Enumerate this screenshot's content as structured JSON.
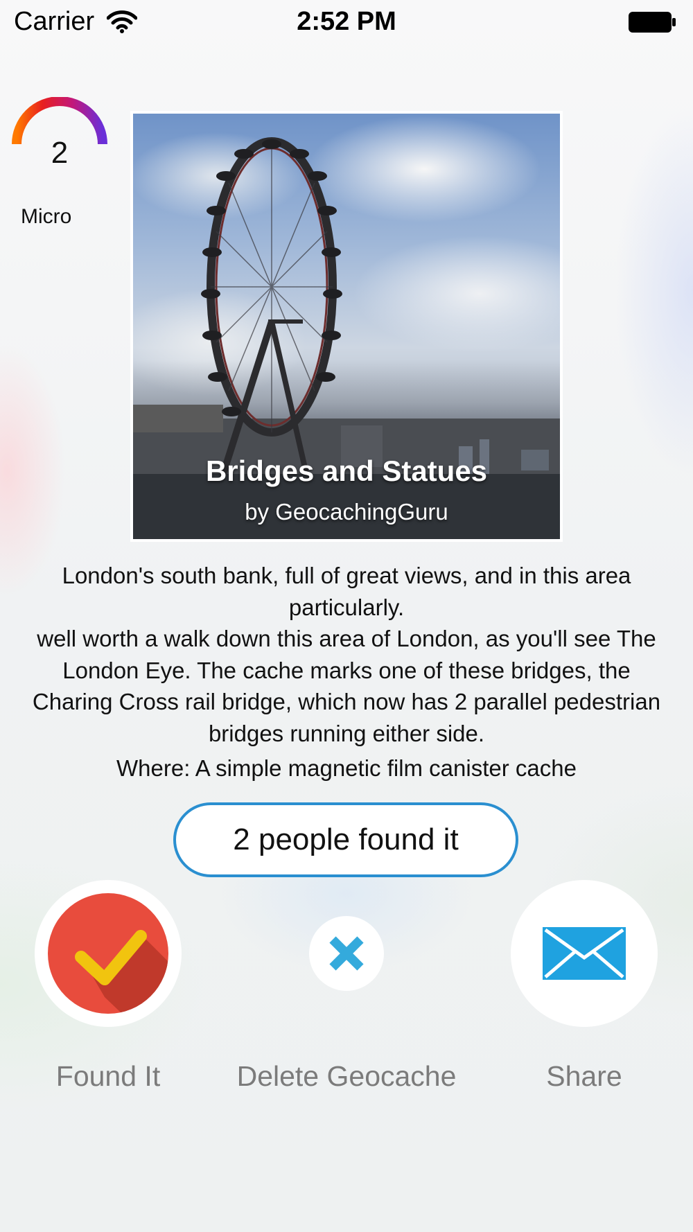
{
  "status_bar": {
    "carrier": "Carrier",
    "time": "2:52 PM",
    "wifi_icon": "wifi-icon",
    "battery_icon": "battery-icon"
  },
  "cache": {
    "difficulty": "2",
    "size": "Micro",
    "title": "Bridges and Statues",
    "author": "by GeocachingGuru",
    "description_line1": "London's south bank, full of great views, and in this area particularly.",
    "description_line2": "well worth a walk down this area of London, as you'll see The London Eye. The cache marks one of these bridges, the Charing Cross rail bridge, which now has 2 parallel pedestrian bridges running either side.",
    "where": "Where: A simple magnetic film canister cache",
    "found_count": "2 people found it"
  },
  "actions": {
    "found_label": "Found It",
    "delete_label": "Delete Geocache",
    "share_label": "Share"
  },
  "colors": {
    "accent_blue": "#2a8fd0",
    "found_red": "#e84c3d",
    "check_yellow": "#f1c40f",
    "delete_blue": "#34aadc",
    "share_blue": "#1fa2e0",
    "label_gray": "#7b7b7b"
  }
}
